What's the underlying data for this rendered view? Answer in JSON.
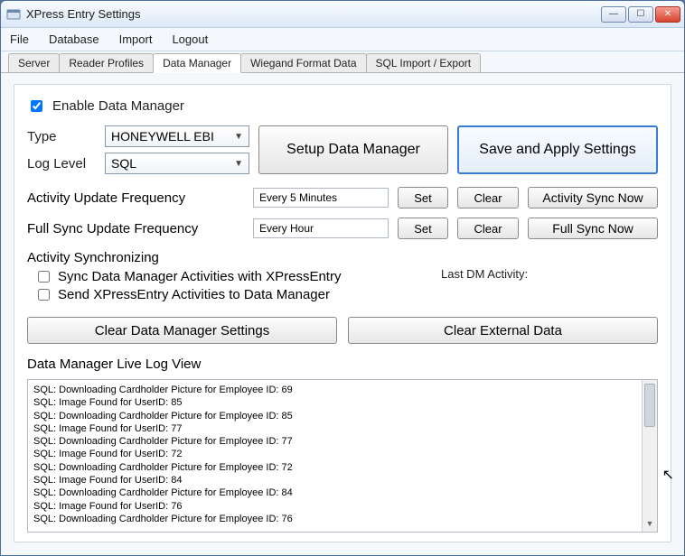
{
  "window": {
    "title": "XPress Entry Settings"
  },
  "menubar": [
    "File",
    "Database",
    "Import",
    "Logout"
  ],
  "tabs": [
    {
      "label": "Server",
      "active": false
    },
    {
      "label": "Reader Profiles",
      "active": false
    },
    {
      "label": "Data Manager",
      "active": true
    },
    {
      "label": "Wiegand Format Data",
      "active": false
    },
    {
      "label": "SQL Import / Export",
      "active": false
    }
  ],
  "enable": {
    "label": "Enable Data Manager",
    "checked": true
  },
  "type": {
    "label": "Type",
    "value": "HONEYWELL EBI"
  },
  "log_level": {
    "label": "Log Level",
    "value": "SQL"
  },
  "buttons": {
    "setup": "Setup Data Manager",
    "save": "Save and Apply Settings",
    "activity_set": "Set",
    "activity_clear": "Clear",
    "activity_sync": "Activity Sync Now",
    "full_set": "Set",
    "full_clear": "Clear",
    "full_sync": "Full Sync Now",
    "clear_dm": "Clear Data Manager Settings",
    "clear_ext": "Clear External Data"
  },
  "freq": {
    "activity_label": "Activity Update Frequency",
    "activity_value": "Every 5 Minutes",
    "full_label": "Full Sync Update Frequency",
    "full_value": "Every Hour"
  },
  "sync": {
    "group_title": "Activity Synchronizing",
    "opt1": "Sync Data Manager Activities with XPressEntry",
    "opt2": "Send XPressEntry Activities to Data Manager",
    "last_activity_label": "Last DM Activity:"
  },
  "log": {
    "title": "Data Manager Live Log View",
    "lines": [
      "SQL: Downloading Cardholder Picture for Employee ID: 69",
      "SQL: Image Found for UserID: 85",
      "SQL: Downloading Cardholder Picture for Employee ID: 85",
      "SQL: Image Found for UserID: 77",
      "SQL: Downloading Cardholder Picture for Employee ID: 77",
      "SQL: Image Found for UserID: 72",
      "SQL: Downloading Cardholder Picture for Employee ID: 72",
      "SQL: Image Found for UserID: 84",
      "SQL: Downloading Cardholder Picture for Employee ID: 84",
      "SQL: Image Found for UserID: 76",
      "SQL: Downloading Cardholder Picture for Employee ID: 76"
    ]
  }
}
